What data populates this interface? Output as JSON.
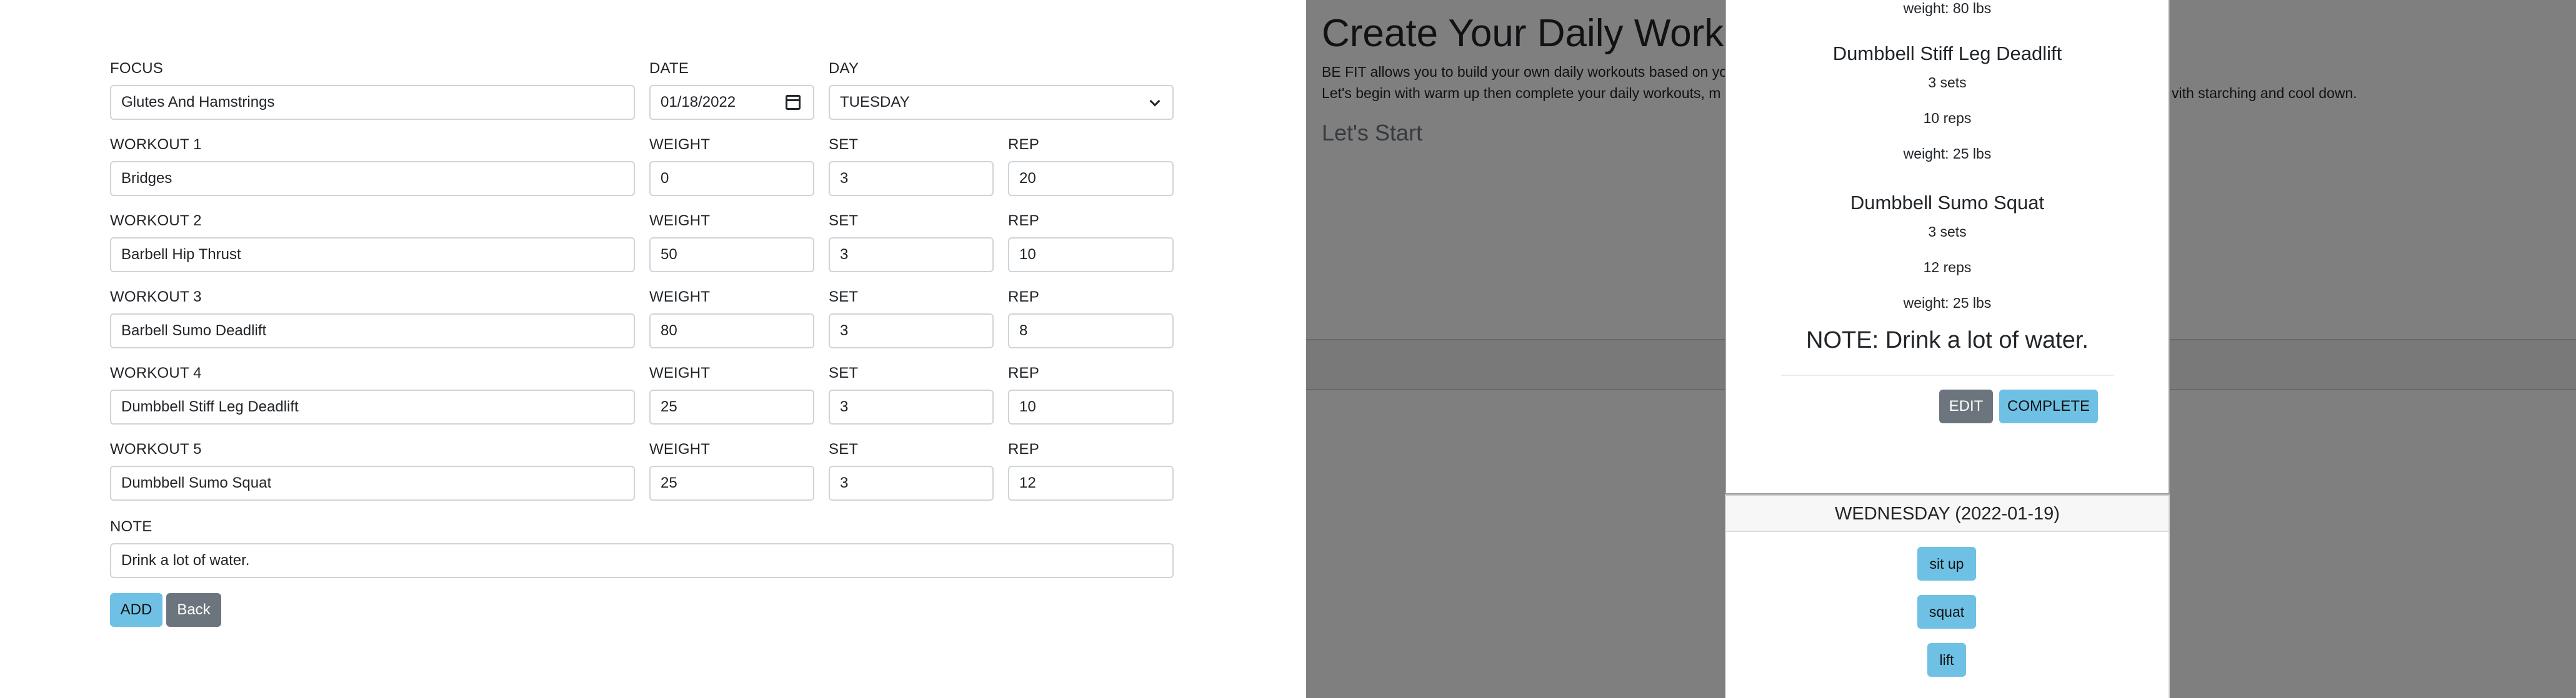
{
  "form": {
    "focus": {
      "label": "FOCUS",
      "value": "Glutes And Hamstrings"
    },
    "date": {
      "label": "DATE",
      "value": "01/18/2022"
    },
    "day": {
      "label": "DAY",
      "value": "TUESDAY"
    },
    "weight_label": "WEIGHT",
    "set_label": "SET",
    "rep_label": "REP",
    "workouts": [
      {
        "label": "WORKOUT 1",
        "name": "Bridges",
        "weight": "0",
        "set": "3",
        "rep": "20"
      },
      {
        "label": "WORKOUT 2",
        "name": "Barbell Hip Thrust",
        "weight": "50",
        "set": "3",
        "rep": "10"
      },
      {
        "label": "WORKOUT 3",
        "name": "Barbell Sumo Deadlift",
        "weight": "80",
        "set": "3",
        "rep": "8"
      },
      {
        "label": "WORKOUT 4",
        "name": "Dumbbell Stiff Leg Deadlift",
        "weight": "25",
        "set": "3",
        "rep": "10"
      },
      {
        "label": "WORKOUT 5",
        "name": "Dumbbell Sumo Squat",
        "weight": "25",
        "set": "3",
        "rep": "12"
      }
    ],
    "note": {
      "label": "NOTE",
      "value": "Drink a lot of water."
    },
    "add_label": "ADD",
    "back_label": "Back"
  },
  "background": {
    "title": "Create Your Daily Workout",
    "line1": "BE FIT allows you to build your own daily workouts based on yo",
    "line2": "Let's begin with warm up then complete your daily workouts, m",
    "line2_right": "vith starching and cool down.",
    "subtitle": "Let's Start"
  },
  "modal": {
    "top_weight": "weight: 80 lbs",
    "exercises": [
      {
        "name": "Dumbbell Stiff Leg Deadlift",
        "sets": "3 sets",
        "reps": "10 reps",
        "weight": "weight: 25 lbs"
      },
      {
        "name": "Dumbbell Sumo Squat",
        "sets": "3 sets",
        "reps": "12 reps",
        "weight": "weight: 25 lbs"
      }
    ],
    "note": "NOTE: Drink a lot of water.",
    "edit_label": "EDIT",
    "complete_label": "COMPLETE"
  },
  "day_card": {
    "title": "WEDNESDAY (2022-01-19)",
    "items": [
      "sit up",
      "squat",
      "lift"
    ]
  },
  "colors": {
    "info": "#6ec1e4",
    "secondary": "#6c757d",
    "overlay": "rgba(0,0,0,0.5)"
  }
}
